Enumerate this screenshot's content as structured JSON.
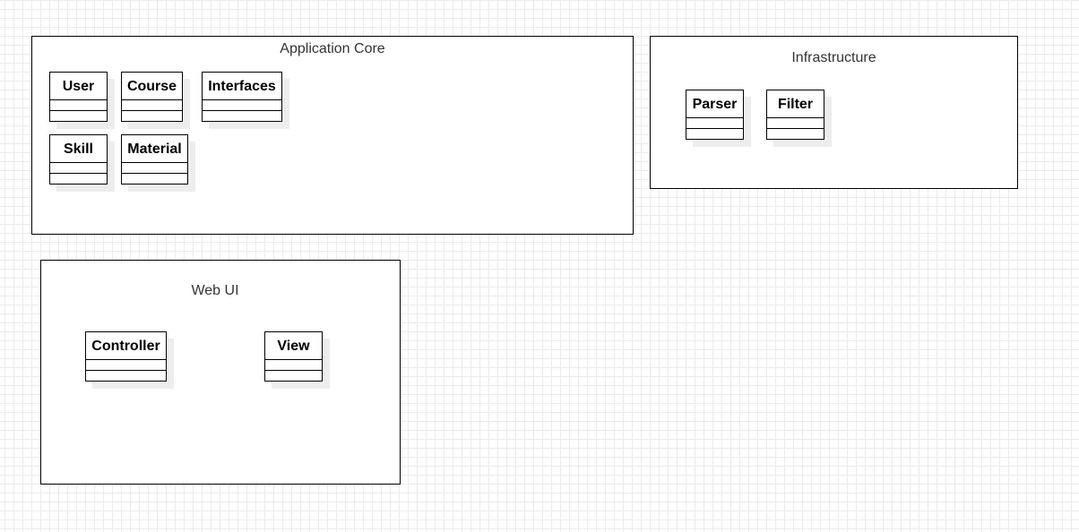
{
  "colors": {
    "background": "#ffffff",
    "grid": "#ebebeb",
    "stroke": "#000000",
    "package_label": "#333333",
    "shadow": "#ededed"
  },
  "packages": [
    {
      "id": "application-core",
      "label": "Application Core",
      "classes": [
        {
          "name": "User"
        },
        {
          "name": "Course"
        },
        {
          "name": "Interfaces"
        },
        {
          "name": "Skill"
        },
        {
          "name": "Material"
        }
      ]
    },
    {
      "id": "infrastructure",
      "label": "Infrastructure",
      "classes": [
        {
          "name": "Parser"
        },
        {
          "name": "Filter"
        }
      ]
    },
    {
      "id": "web-ui",
      "label": "Web UI",
      "classes": [
        {
          "name": "Controller"
        },
        {
          "name": "View"
        }
      ]
    }
  ]
}
